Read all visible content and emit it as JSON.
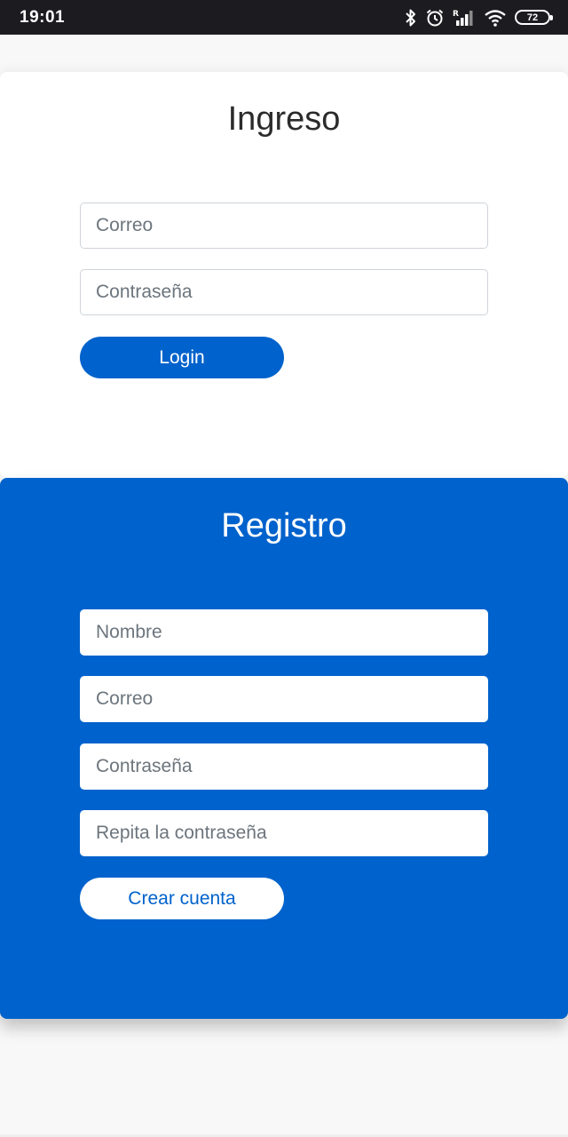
{
  "status_bar": {
    "time": "19:01",
    "battery_level": "72",
    "icons": [
      "bluetooth-icon",
      "alarm-icon",
      "signal-icon",
      "wifi-icon",
      "battery-icon"
    ]
  },
  "login": {
    "title": "Ingreso",
    "email_placeholder": "Correo",
    "password_placeholder": "Contraseña",
    "button_label": "Login"
  },
  "register": {
    "title": "Registro",
    "name_placeholder": "Nombre",
    "email_placeholder": "Correo",
    "password_placeholder": "Contraseña",
    "repeat_password_placeholder": "Repita la contraseña",
    "button_label": "Crear cuenta"
  },
  "colors": {
    "primary": "#0062cc",
    "status_bar": "#1c1b20",
    "card_background": "#ffffff"
  }
}
